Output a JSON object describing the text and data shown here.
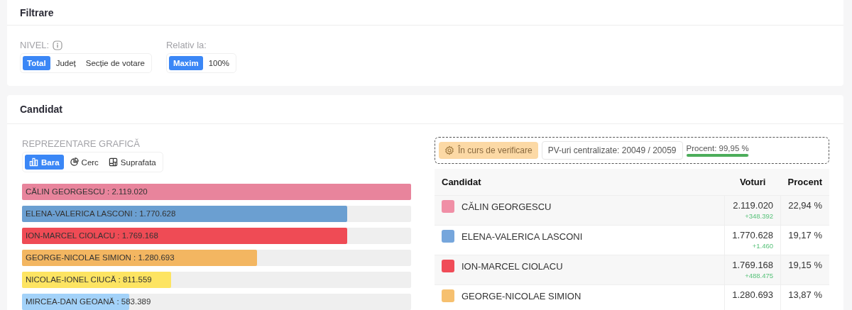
{
  "filter": {
    "title": "Filtrare",
    "level": {
      "label": "NIVEL:",
      "options": [
        {
          "label": "Total",
          "selected": true
        },
        {
          "label": "Județ",
          "selected": false
        },
        {
          "label": "Secție de votare",
          "selected": false
        }
      ]
    },
    "relative": {
      "label": "Relativ la:",
      "options": [
        {
          "label": "Maxim",
          "selected": true
        },
        {
          "label": "100%",
          "selected": false
        }
      ]
    }
  },
  "candidate": {
    "title": "Candidat",
    "chart_label": "REPREZENTARE GRAFICĂ",
    "views": [
      {
        "label": "Bara",
        "kind": "bar",
        "selected": true
      },
      {
        "label": "Cerc",
        "kind": "pie",
        "selected": false
      },
      {
        "label": "Suprafata",
        "kind": "area",
        "selected": false
      }
    ],
    "bars": [
      {
        "label": "CĂLIN GEORGESCU : 2.119.020",
        "level": 1,
        "color": "#e8849c"
      },
      {
        "label": "ELENA-VALERICA LASCONI : 1.770.628",
        "level": 0.836,
        "color": "#6b9fd1"
      },
      {
        "label": "ION-MARCEL CIOLACU : 1.769.168",
        "level": 0.835,
        "color": "#ef4b55"
      },
      {
        "label": "GEORGE-NICOLAE SIMION : 1.280.693",
        "level": 0.604,
        "color": "#f3b661"
      },
      {
        "label": "NICOLAE-IONEL CIUCĂ : 811.559",
        "level": 0.383,
        "color": "#fde462"
      },
      {
        "label": "MIRCEA-DAN GEOANĂ : 583.389",
        "level": 0.275,
        "color": "#a3d2f9"
      }
    ],
    "status": {
      "badge": "În curs de verificare",
      "count": "PV-uri centralizate: 20049 / 20059",
      "percent": "Procent: 99,95 %",
      "level": 0.9995
    },
    "table": {
      "columns": [
        "Candidat",
        "Voturi",
        "Procent"
      ],
      "rows": [
        {
          "name": "CĂLIN GEORGESCU",
          "color": "#f08fa6",
          "votes": "2.119.020",
          "delta": "+348.392",
          "percent": "22,94 %"
        },
        {
          "name": "ELENA-VALERICA LASCONI",
          "color": "#76a6dc",
          "votes": "1.770.628",
          "delta": "+1.460",
          "percent": "19,17 %"
        },
        {
          "name": "ION-MARCEL CIOLACU",
          "color": "#f04c58",
          "votes": "1.769.168",
          "delta": "+488.475",
          "percent": "19,15 %"
        },
        {
          "name": "GEORGE-NICOLAE SIMION",
          "color": "#f6c06f",
          "votes": "1.280.693",
          "percent": "13,87 %"
        }
      ]
    }
  }
}
